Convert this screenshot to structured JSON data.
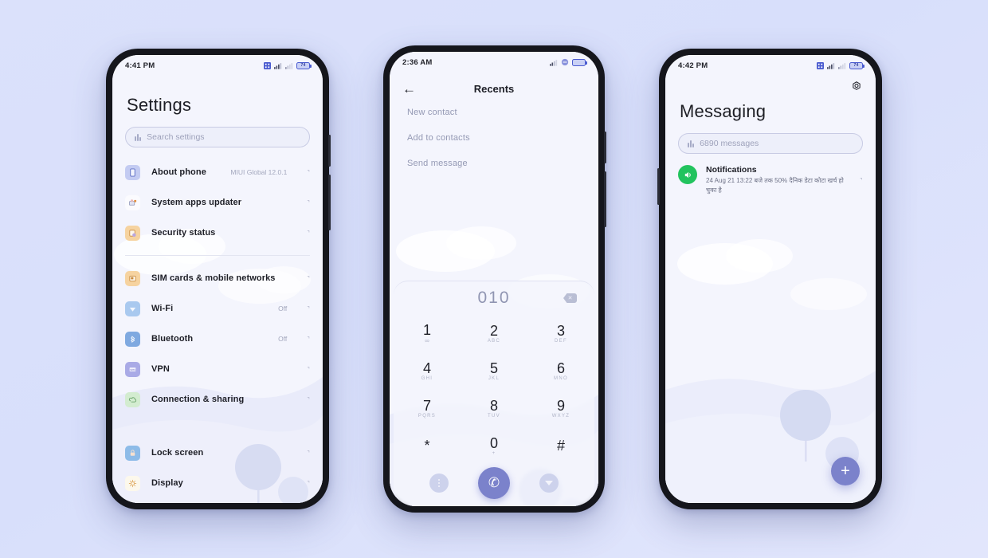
{
  "background_color": "#d8dffb",
  "accent_color": "#7b82cb",
  "phones": {
    "settings": {
      "status_bar": {
        "time": "4:41 PM",
        "battery_level": "74"
      },
      "title": "Settings",
      "search": {
        "placeholder": "Search settings",
        "icon": "search-bars-icon"
      },
      "items": [
        {
          "label": "About phone",
          "value": "MIUI Global 12.0.1",
          "icon": "phone-info-icon",
          "icon_bg": "#c3cbf2",
          "icon_fg": "#5d6cc4"
        },
        {
          "label": "System apps updater",
          "value": "",
          "icon": "app-update-icon",
          "icon_bg": "#fbfbfe",
          "icon_fg": "#8a8fae"
        },
        {
          "label": "Security status",
          "value": "",
          "icon": "security-shield-icon",
          "icon_bg": "#f6d3a0",
          "icon_fg": "#c98b3e"
        },
        {
          "label": "SIM cards & mobile networks",
          "value": "",
          "icon": "sim-card-icon",
          "icon_bg": "#f6d3a0",
          "icon_fg": "#c98b3e"
        },
        {
          "label": "Wi-Fi",
          "value": "Off",
          "icon": "wifi-icon",
          "icon_bg": "#a9c9ef",
          "icon_fg": "#f4f7fd"
        },
        {
          "label": "Bluetooth",
          "value": "Off",
          "icon": "bluetooth-icon",
          "icon_bg": "#7fa9e0",
          "icon_fg": "#eaf1fb"
        },
        {
          "label": "VPN",
          "value": "",
          "icon": "vpn-icon",
          "icon_bg": "#a9aae6",
          "icon_fg": "#f0f0fc"
        },
        {
          "label": "Connection & sharing",
          "value": "",
          "icon": "connection-sharing-icon",
          "icon_bg": "#d3ecd0",
          "icon_fg": "#6aa36a"
        },
        {
          "label": "Lock screen",
          "value": "",
          "icon": "lock-icon",
          "icon_bg": "#8dbbe8",
          "icon_fg": "#f6e0cf"
        },
        {
          "label": "Display",
          "value": "",
          "icon": "brightness-sun-icon",
          "icon_bg": "#fcf8ec",
          "icon_fg": "#e0ab63"
        }
      ],
      "divider_after_index": 2
    },
    "dialer": {
      "status_bar": {
        "time": "2:36 AM",
        "battery_level": ""
      },
      "back_icon": "back-arrow-icon",
      "title": "Recents",
      "actions": [
        "New contact",
        "Add to contacts",
        "Send message"
      ],
      "dialed_number": "010",
      "backspace_icon": "backspace-icon",
      "keys": [
        {
          "num": "1",
          "sub": "∞"
        },
        {
          "num": "2",
          "sub": "ABC"
        },
        {
          "num": "3",
          "sub": "DEF"
        },
        {
          "num": "4",
          "sub": "GHI"
        },
        {
          "num": "5",
          "sub": "JKL"
        },
        {
          "num": "6",
          "sub": "MNO"
        },
        {
          "num": "7",
          "sub": "PQRS"
        },
        {
          "num": "8",
          "sub": "TUV"
        },
        {
          "num": "9",
          "sub": "WXYZ"
        },
        {
          "num": "*",
          "sub": ""
        },
        {
          "num": "0",
          "sub": "+"
        },
        {
          "num": "#",
          "sub": ""
        }
      ],
      "bottom_actions": {
        "menu_icon": "kebab-menu-icon",
        "call_icon": "phone-call-icon",
        "hide_icon": "chevron-down-icon"
      }
    },
    "messaging": {
      "status_bar": {
        "time": "4:42 PM",
        "battery_level": "74"
      },
      "settings_icon": "gear-icon",
      "title": "Messaging",
      "search": {
        "placeholder": "6890 messages",
        "icon": "search-bars-icon"
      },
      "notification": {
        "avatar_icon": "speaker-volume-icon",
        "avatar_color": "#22c35e",
        "title": "Notifications",
        "text": "24 Aug 21 13:22 बजे तक 50% दैनिक डेटा कोटा खर्च हो चुका है"
      },
      "fab": {
        "icon": "plus-icon",
        "label": "+"
      }
    }
  }
}
